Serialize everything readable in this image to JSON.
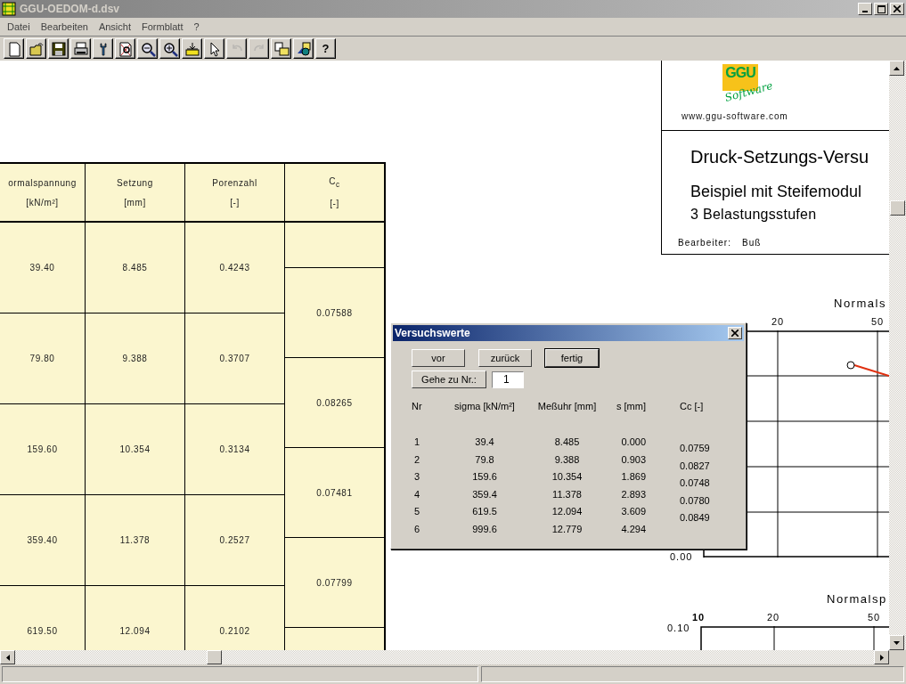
{
  "window": {
    "title": "GGU-OEDOM-d.dsv"
  },
  "menu": [
    "Datei",
    "Bearbeiten",
    "Ansicht",
    "Formblatt",
    "?"
  ],
  "toolbar": [
    {
      "kind": "new",
      "disabled": false
    },
    {
      "kind": "open",
      "disabled": false
    },
    {
      "kind": "save",
      "disabled": false
    },
    {
      "kind": "print",
      "disabled": false
    },
    {
      "kind": "tool",
      "disabled": false
    },
    {
      "kind": "preview",
      "disabled": false
    },
    {
      "kind": "zoom-out",
      "disabled": false
    },
    {
      "kind": "zoom-in",
      "disabled": false
    },
    {
      "kind": "insert",
      "disabled": false
    },
    {
      "kind": "pointer",
      "disabled": false
    },
    {
      "kind": "undo",
      "disabled": true
    },
    {
      "kind": "redo",
      "disabled": true
    },
    {
      "kind": "copy",
      "disabled": false
    },
    {
      "kind": "shapes",
      "disabled": false
    },
    {
      "kind": "text",
      "label": "?",
      "disabled": false
    }
  ],
  "document": {
    "header": {
      "logo": {
        "mark": "GGU",
        "script": "Software"
      },
      "url": "www.ggu-software.com",
      "title": "Druck-Setzungs-Versu",
      "subtitle": "Beispiel mit Steifemodul",
      "stages": "3 Belastungsstufen",
      "editor_label": "Bearbeiter:",
      "editor": "Buß"
    },
    "table": {
      "columns": [
        {
          "title": "ormalspannung",
          "unit": "[kN/m²]"
        },
        {
          "title": "Setzung",
          "unit": "[mm]"
        },
        {
          "title": "Porenzahl",
          "unit": "[-]"
        },
        {
          "title": "C$_{c}$",
          "unit": "[-]"
        }
      ],
      "rows": [
        [
          "39.40",
          "8.485",
          "0.4243"
        ],
        [
          "79.80",
          "9.388",
          "0.3707"
        ],
        [
          "159.60",
          "10.354",
          "0.3134"
        ],
        [
          "359.40",
          "11.378",
          "0.2527"
        ],
        [
          "619.50",
          "12.094",
          "0.2102"
        ]
      ],
      "cc_values": [
        "0.07588",
        "0.08265",
        "0.07481",
        "0.07799"
      ]
    },
    "charts": [
      {
        "title": "Normals",
        "x_ticks": [
          "20",
          "50"
        ],
        "y_tick": "0.00",
        "curve": true
      },
      {
        "title": "Normalsp",
        "x_ticks": [
          "10",
          "20",
          "50"
        ],
        "y_tick": "0.10"
      }
    ]
  },
  "dialog": {
    "title": "Versuchswerte",
    "buttons": [
      {
        "label": "vor",
        "default": false
      },
      {
        "label": "zurück",
        "default": false
      },
      {
        "label": "fertig",
        "default": true
      }
    ],
    "goto": {
      "label": "Gehe zu Nr.:",
      "value": "1"
    },
    "columns": [
      "Nr",
      "sigma [kN/m²]",
      "Meßuhr [mm]",
      "s [mm]",
      "Cc [-]"
    ],
    "rows": [
      [
        "1",
        "39.4",
        "8.485",
        "0.000"
      ],
      [
        "2",
        "79.8",
        "9.388",
        "0.903"
      ],
      [
        "3",
        "159.6",
        "10.354",
        "1.869"
      ],
      [
        "4",
        "359.4",
        "11.378",
        "2.893"
      ],
      [
        "5",
        "619.5",
        "12.094",
        "3.609"
      ],
      [
        "6",
        "999.6",
        "12.779",
        "4.294"
      ]
    ],
    "cc_values": [
      "0.0759",
      "0.0827",
      "0.0748",
      "0.0780",
      "0.0849"
    ]
  }
}
